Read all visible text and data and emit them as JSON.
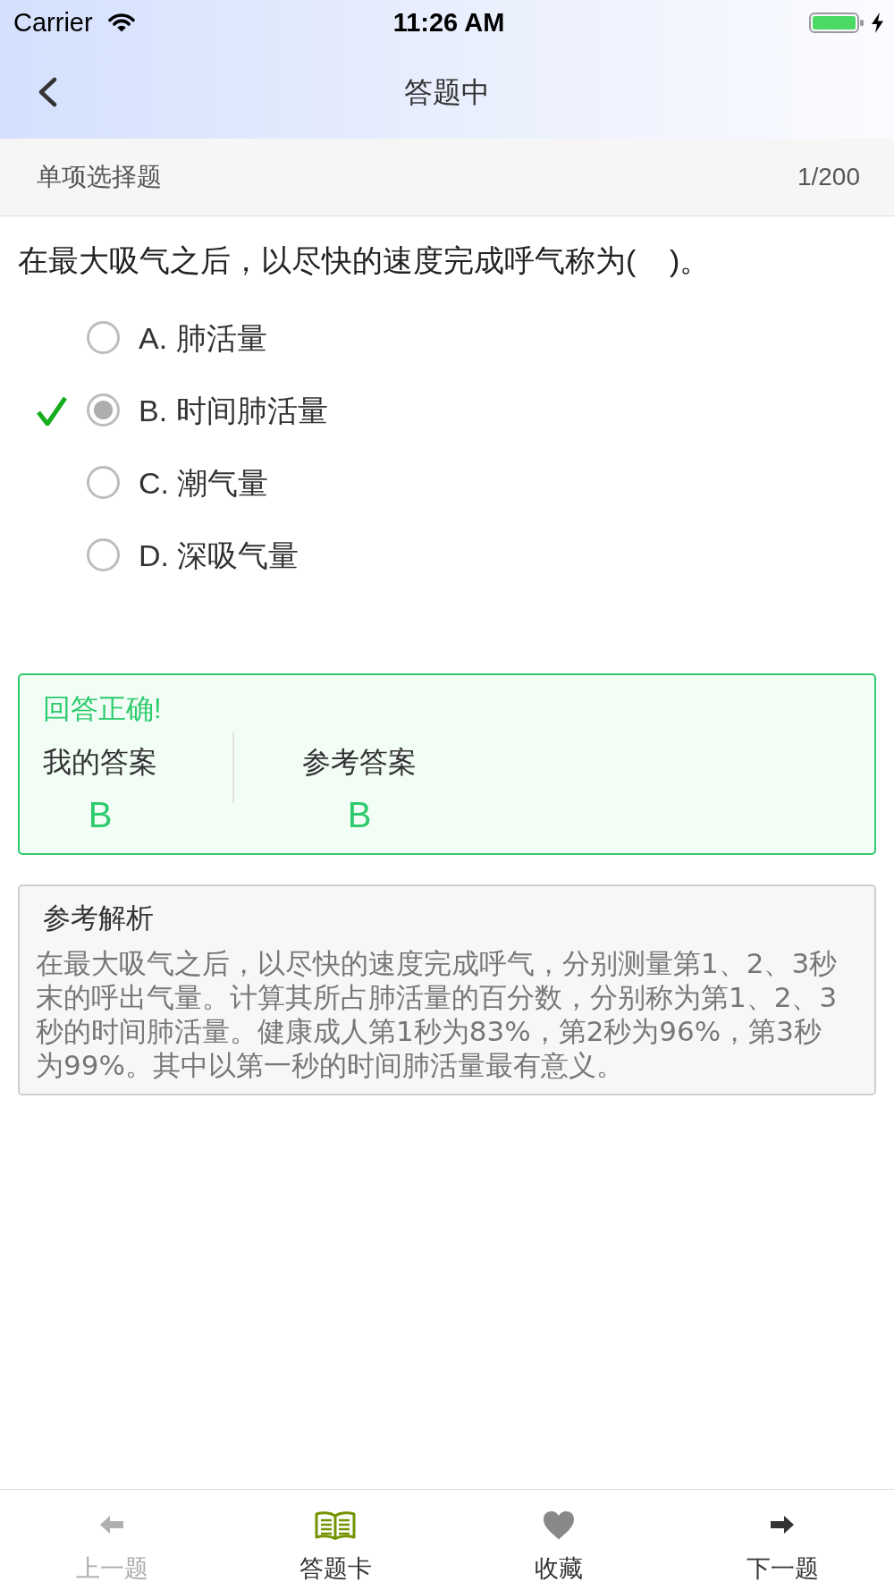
{
  "status_bar": {
    "carrier": "Carrier",
    "time": "11:26 AM"
  },
  "nav_bar": {
    "title": "答题中"
  },
  "question_header": {
    "type": "单项选择题",
    "number": "1/200"
  },
  "question": {
    "text": "在最大吸气之后，以尽快的速度完成呼气称为(    )。",
    "options": [
      {
        "label": "A. 肺活量",
        "selected": false,
        "correct": false
      },
      {
        "label": "B. 时间肺活量",
        "selected": true,
        "correct": true
      },
      {
        "label": "C. 潮气量",
        "selected": false,
        "correct": false
      },
      {
        "label": "D. 深吸气量",
        "selected": false,
        "correct": false
      }
    ]
  },
  "result": {
    "verdict": "回答正确!",
    "correct": true,
    "my_answer_label": "我的答案",
    "my_answer": "B",
    "reference_label": "参考答案",
    "reference_answer": "B"
  },
  "analysis": {
    "title": "参考解析",
    "text": "在最大吸气之后，以尽快的速度完成呼气，分别测量第1、2、3秒末的呼出气量。计算其所占肺活量的百分数，分别称为第1、2、3秒的时间肺活量。健康成人第1秒为83%，第2秒为96%，第3秒为99%。其中以第一秒的时间肺活量最有意义。"
  },
  "toolbar": [
    {
      "kind": "prev",
      "label": "上一题",
      "disabled": true
    },
    {
      "kind": "answer_card",
      "label": "答题卡",
      "disabled": false
    },
    {
      "kind": "favorite",
      "label": "收藏",
      "disabled": false
    },
    {
      "kind": "next",
      "label": "下一题",
      "disabled": false
    }
  ]
}
